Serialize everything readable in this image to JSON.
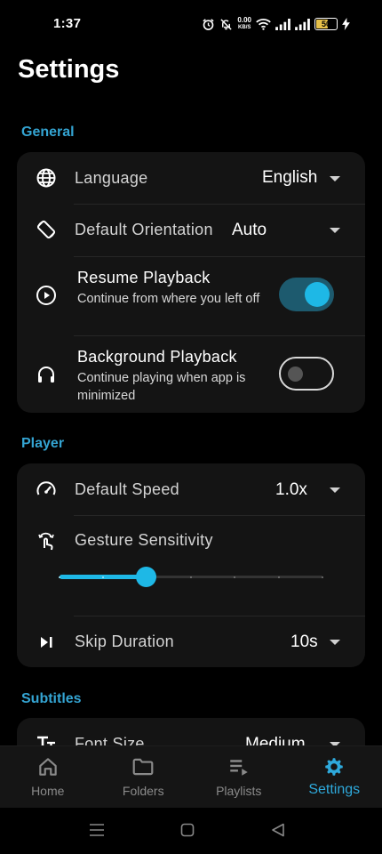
{
  "status_bar": {
    "time": "1:37",
    "net_speed_value": "0.00",
    "net_speed_unit": "KB/S",
    "battery": "50",
    "icons": [
      "alarm-icon",
      "mute-icon",
      "wifi-icon",
      "signal-icon",
      "signal-icon",
      "battery-icon",
      "charging-icon"
    ]
  },
  "page_title": "Settings",
  "sections": {
    "general": {
      "title": "General",
      "language": {
        "label": "Language",
        "value": "English",
        "icon": "globe-icon"
      },
      "orientation": {
        "label": "Default Orientation",
        "value": "Auto",
        "icon": "screen-rotation-icon"
      },
      "resume": {
        "label": "Resume Playback",
        "description": "Continue from where you left off",
        "enabled": true,
        "icon": "play-circle-icon"
      },
      "background": {
        "label": "Background Playback",
        "description": "Continue playing when app is minimized",
        "enabled": false,
        "icon": "headphones-icon"
      }
    },
    "player": {
      "title": "Player",
      "speed": {
        "label": "Default Speed",
        "value": "1.0x",
        "icon": "speedometer-icon"
      },
      "gesture": {
        "label": "Gesture Sensitivity",
        "icon": "gesture-icon",
        "slider_position": 0.33,
        "steps": 7
      },
      "skip": {
        "label": "Skip Duration",
        "value": "10s",
        "icon": "skip-next-icon"
      }
    },
    "subtitles": {
      "title": "Subtitles",
      "font_size": {
        "label": "Font Size",
        "value": "Medium",
        "icon": "text-size-icon"
      }
    }
  },
  "bottom_nav": [
    {
      "label": "Home",
      "icon": "home-icon",
      "active": false
    },
    {
      "label": "Folders",
      "icon": "folder-icon",
      "active": false
    },
    {
      "label": "Playlists",
      "icon": "playlist-icon",
      "active": false
    },
    {
      "label": "Settings",
      "icon": "gear-icon",
      "active": true
    }
  ],
  "colors": {
    "accent": "#1eb8e6",
    "section_title": "#34a4d2",
    "card_background": "#141414",
    "background": "#000000"
  }
}
